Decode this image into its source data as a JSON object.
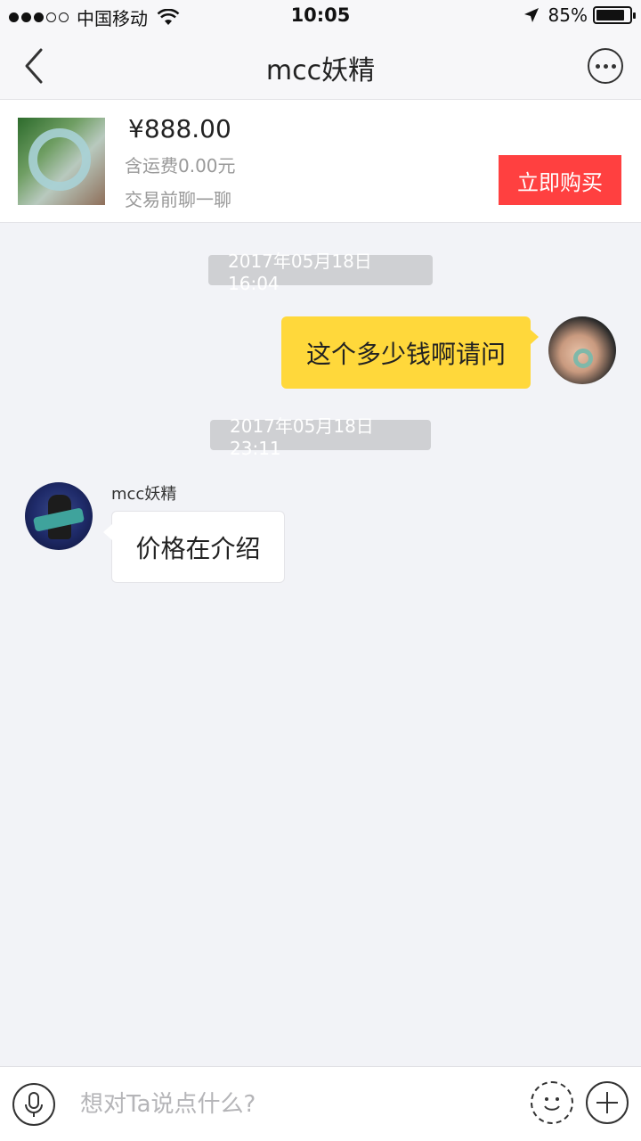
{
  "status_bar": {
    "carrier": "中国移动",
    "time": "10:05",
    "battery_percent": "85%",
    "battery_level": 0.85
  },
  "nav": {
    "title": "mcc妖精"
  },
  "product": {
    "price": "¥888.00",
    "shipping": "含运费0.00元",
    "note": "交易前聊一聊",
    "buy_label": "立即购买"
  },
  "chat": {
    "messages": [
      {
        "timestamp": "2017年05月18日 16:04",
        "sender": "self",
        "text": "这个多少钱啊请问"
      },
      {
        "timestamp": "2017年05月18日 23:11",
        "sender": "mcc妖精",
        "text": "价格在介绍"
      }
    ]
  },
  "input": {
    "placeholder": "想对Ta说点什么?"
  },
  "colors": {
    "self_bubble": "#ffd83b",
    "buy_button": "#ff4040",
    "background": "#f2f3f7"
  },
  "icons": [
    "back-icon",
    "more-icon",
    "wifi-icon",
    "location-arrow-icon",
    "battery-icon",
    "microphone-icon",
    "emoji-icon",
    "plus-icon"
  ]
}
